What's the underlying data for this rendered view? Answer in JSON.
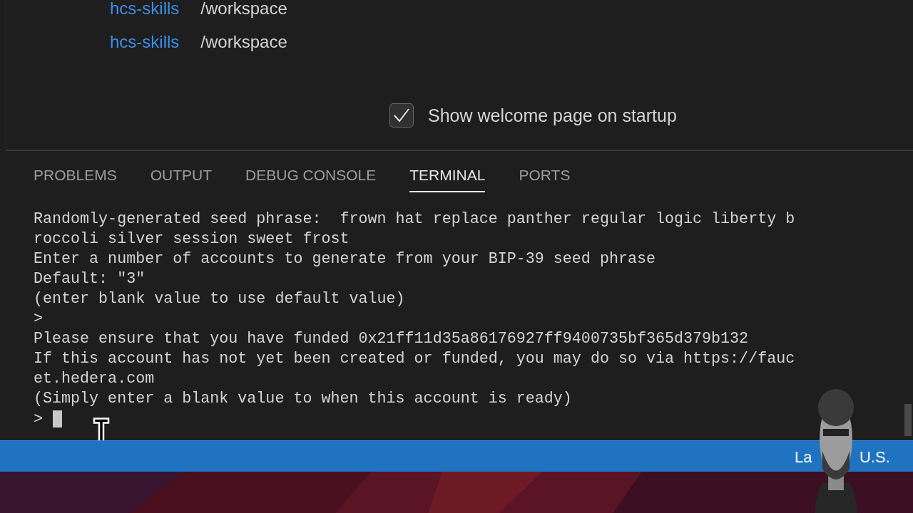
{
  "welcome": {
    "recent": [
      {
        "name": "hcs-skills",
        "path": "/workspace"
      },
      {
        "name": "hcs-skills",
        "path": "/workspace"
      }
    ],
    "startup_checkbox": {
      "label": "Show welcome page on startup",
      "checked": true
    }
  },
  "panel": {
    "tabs": [
      {
        "label": "PROBLEMS",
        "selected": false
      },
      {
        "label": "OUTPUT",
        "selected": false
      },
      {
        "label": "DEBUG CONSOLE",
        "selected": false
      },
      {
        "label": "TERMINAL",
        "selected": true
      },
      {
        "label": "PORTS",
        "selected": false
      }
    ],
    "terminal": {
      "lines": [
        "Randomly-generated seed phrase:  frown hat replace panther regular logic liberty b",
        "roccoli silver session sweet frost",
        "Enter a number of accounts to generate from your BIP-39 seed phrase",
        "Default: \"3\"",
        "(enter blank value to use default value)",
        ">",
        "Please ensure that you have funded 0x21ff11d35a86176927ff9400735bf365d379b132",
        "If this account has not yet been created or funded, you may do so via https://fauc",
        "et.hedera.com",
        "(Simply enter a blank value to when this account is ready)"
      ],
      "prompt": ">"
    }
  },
  "status_bar": {
    "items": [
      "La",
      "U.S."
    ]
  }
}
